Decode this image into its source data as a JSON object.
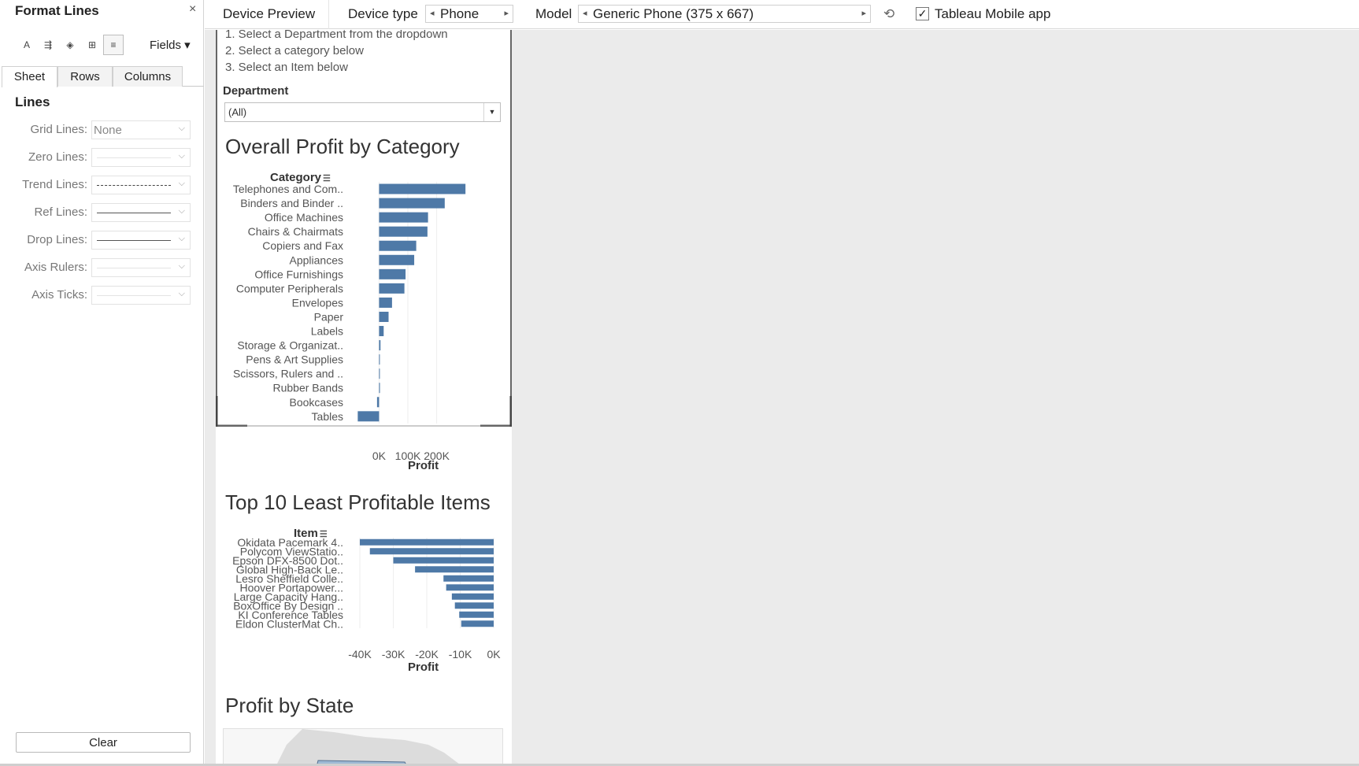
{
  "format_pane": {
    "title": "Format Lines",
    "close_glyph": "×",
    "tools": [
      {
        "icon": "font-icon",
        "glyph": "A"
      },
      {
        "icon": "alignment-icon",
        "glyph": "⇶"
      },
      {
        "icon": "shading-icon",
        "glyph": "◈"
      },
      {
        "icon": "borders-icon",
        "glyph": "⊞"
      },
      {
        "icon": "lines-icon",
        "glyph": "≡"
      }
    ],
    "fields_label": "Fields ▾",
    "tabs": [
      "Sheet",
      "Rows",
      "Columns"
    ],
    "active_tab": "Sheet",
    "section_title": "Lines",
    "rows": [
      {
        "label": "Grid Lines:",
        "value": "None",
        "line": "none"
      },
      {
        "label": "Zero Lines:",
        "value": "",
        "line": "none"
      },
      {
        "label": "Trend Lines:",
        "value": "",
        "line": "dashed"
      },
      {
        "label": "Ref Lines:",
        "value": "",
        "line": "solid"
      },
      {
        "label": "Drop Lines:",
        "value": "",
        "line": "solid"
      },
      {
        "label": "Axis Rulers:",
        "value": "",
        "line": "none"
      },
      {
        "label": "Axis Ticks:",
        "value": "",
        "line": "none"
      }
    ],
    "clear_label": "Clear"
  },
  "device_toolbar": {
    "title": "Device Preview",
    "device_type_label": "Device type",
    "device_type_value": "Phone",
    "model_label": "Model",
    "model_value": "Generic Phone (375 x 667)",
    "mobile_app_checked": "✓",
    "mobile_app_label": "Tableau Mobile app"
  },
  "dashboard": {
    "instructions": [
      "1. Select a Department from the dropdown",
      "2. Select a category below",
      "3. Select an Item below"
    ],
    "department_label": "Department",
    "department_value": "(All)",
    "category_chart_title": "Overall Profit by Category",
    "items_chart_title": "Top 10 Least Profitable Items",
    "map_title": "Profit by State",
    "bar_color": "#4e79a7"
  },
  "chart_data": [
    {
      "type": "bar",
      "orientation": "horizontal",
      "title": "Overall Profit by Category",
      "row_header": "Category",
      "xlabel": "Profit",
      "x_ticks": [
        "0K",
        "100K",
        "200K"
      ],
      "xlim": [
        -75000,
        305000
      ],
      "categories": [
        "Telephones and Com..",
        "Binders and Binder ..",
        "Office Machines",
        "Chairs & Chairmats",
        "Copiers and Fax",
        "Appliances",
        "Office Furnishings",
        "Computer Peripherals",
        "Envelopes",
        "Paper",
        "Labels",
        "Storage & Organizat..",
        "Pens & Art Supplies",
        "Scissors, Rulers and ..",
        "Rubber Bands",
        "Bookcases",
        "Tables"
      ],
      "values": [
        300000,
        228000,
        170000,
        168000,
        129000,
        122000,
        92000,
        88000,
        45000,
        33000,
        16000,
        5000,
        2000,
        1500,
        3000,
        -7000,
        -74000
      ]
    },
    {
      "type": "bar",
      "orientation": "horizontal",
      "title": "Top 10 Least Profitable Items",
      "row_header": "Item",
      "xlabel": "Profit",
      "x_ticks": [
        "-40K",
        "-30K",
        "-20K",
        "-10K",
        "0K"
      ],
      "xlim": [
        -40000,
        0
      ],
      "categories": [
        "Okidata Pacemark 4..",
        "Polycom ViewStatio..",
        "Epson DFX-8500 Dot..",
        "Global High-Back Le..",
        "Lesro Sheffield Colle..",
        "Hoover Portapower...",
        "Large Capacity Hang..",
        "BoxOffice By Design ..",
        "KI Conference Tables",
        "Eldon ClusterMat Ch.."
      ],
      "values": [
        -40000,
        -37000,
        -30000,
        -23500,
        -15000,
        -14200,
        -12500,
        -11600,
        -10300,
        -9700
      ]
    }
  ]
}
